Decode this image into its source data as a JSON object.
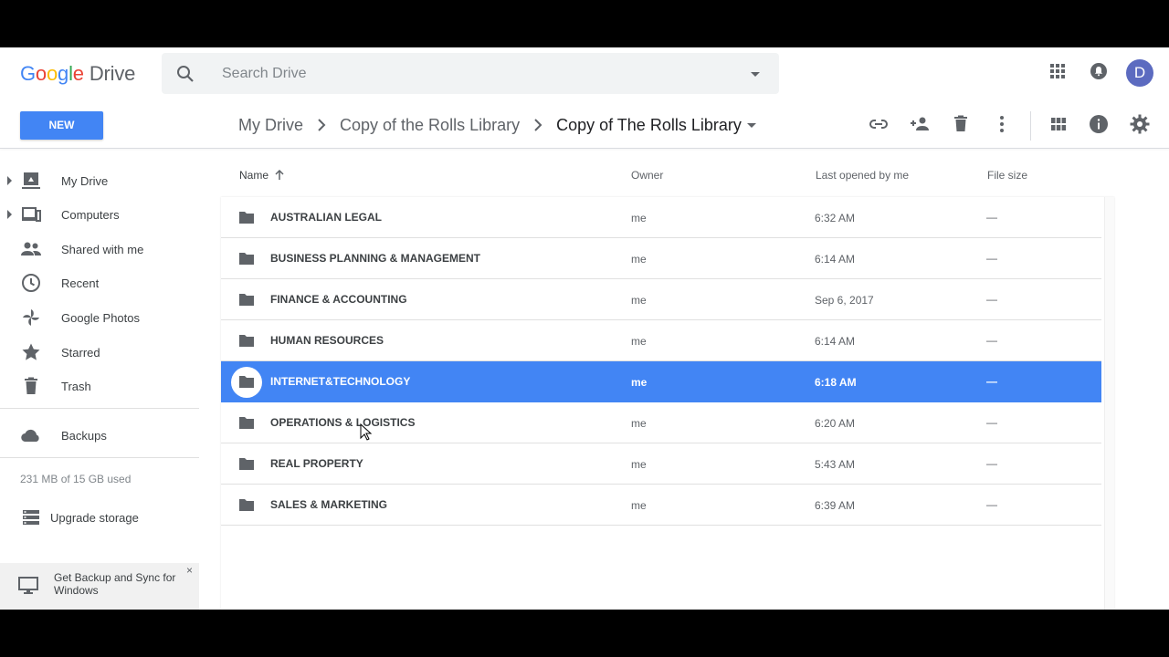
{
  "app": {
    "logo_google": [
      "G",
      "o",
      "o",
      "g",
      "l",
      "e"
    ],
    "logo_drive": "Drive"
  },
  "search": {
    "placeholder": "Search Drive"
  },
  "user": {
    "avatar_letter": "D"
  },
  "new_button": "NEW",
  "breadcrumb": {
    "items": [
      "My Drive",
      "Copy of the Rolls Library"
    ],
    "current": "Copy of The Rolls Library"
  },
  "sidebar": {
    "items": [
      {
        "label": "My Drive",
        "icon": "my-drive-icon"
      },
      {
        "label": "Computers",
        "icon": "computers-icon"
      },
      {
        "label": "Shared with me",
        "icon": "shared-icon"
      },
      {
        "label": "Recent",
        "icon": "clock-icon"
      },
      {
        "label": "Google Photos",
        "icon": "photos-icon"
      },
      {
        "label": "Starred",
        "icon": "star-icon"
      },
      {
        "label": "Trash",
        "icon": "trash-icon"
      },
      {
        "label": "Backups",
        "icon": "cloud-icon"
      }
    ],
    "storage": "231 MB of 15 GB used",
    "upgrade": "Upgrade storage",
    "promo": "Get Backup and Sync for Windows",
    "promo_close": "×"
  },
  "table": {
    "headers": {
      "name": "Name",
      "owner": "Owner",
      "last_opened": "Last opened by me",
      "size": "File size"
    },
    "rows": [
      {
        "name": "AUSTRALIAN LEGAL",
        "owner": "me",
        "date": "6:32 AM",
        "size": "—"
      },
      {
        "name": "BUSINESS PLANNING & MANAGEMENT",
        "owner": "me",
        "date": "6:14 AM",
        "size": "—"
      },
      {
        "name": "FINANCE & ACCOUNTING",
        "owner": "me",
        "date": "Sep 6, 2017",
        "size": "—"
      },
      {
        "name": "HUMAN RESOURCES",
        "owner": "me",
        "date": "6:14 AM",
        "size": "—"
      },
      {
        "name": "INTERNET&TECHNOLOGY",
        "owner": "me",
        "date": "6:18 AM",
        "size": "—",
        "selected": true
      },
      {
        "name": "OPERATIONS & LOGISTICS",
        "owner": "me",
        "date": "6:20 AM",
        "size": "—"
      },
      {
        "name": "REAL PROPERTY",
        "owner": "me",
        "date": "5:43 AM",
        "size": "—"
      },
      {
        "name": "SALES & MARKETING",
        "owner": "me",
        "date": "6:39 AM",
        "size": "—"
      }
    ]
  },
  "colors": {
    "accent": "#4285f4",
    "icon": "#5f6368"
  }
}
